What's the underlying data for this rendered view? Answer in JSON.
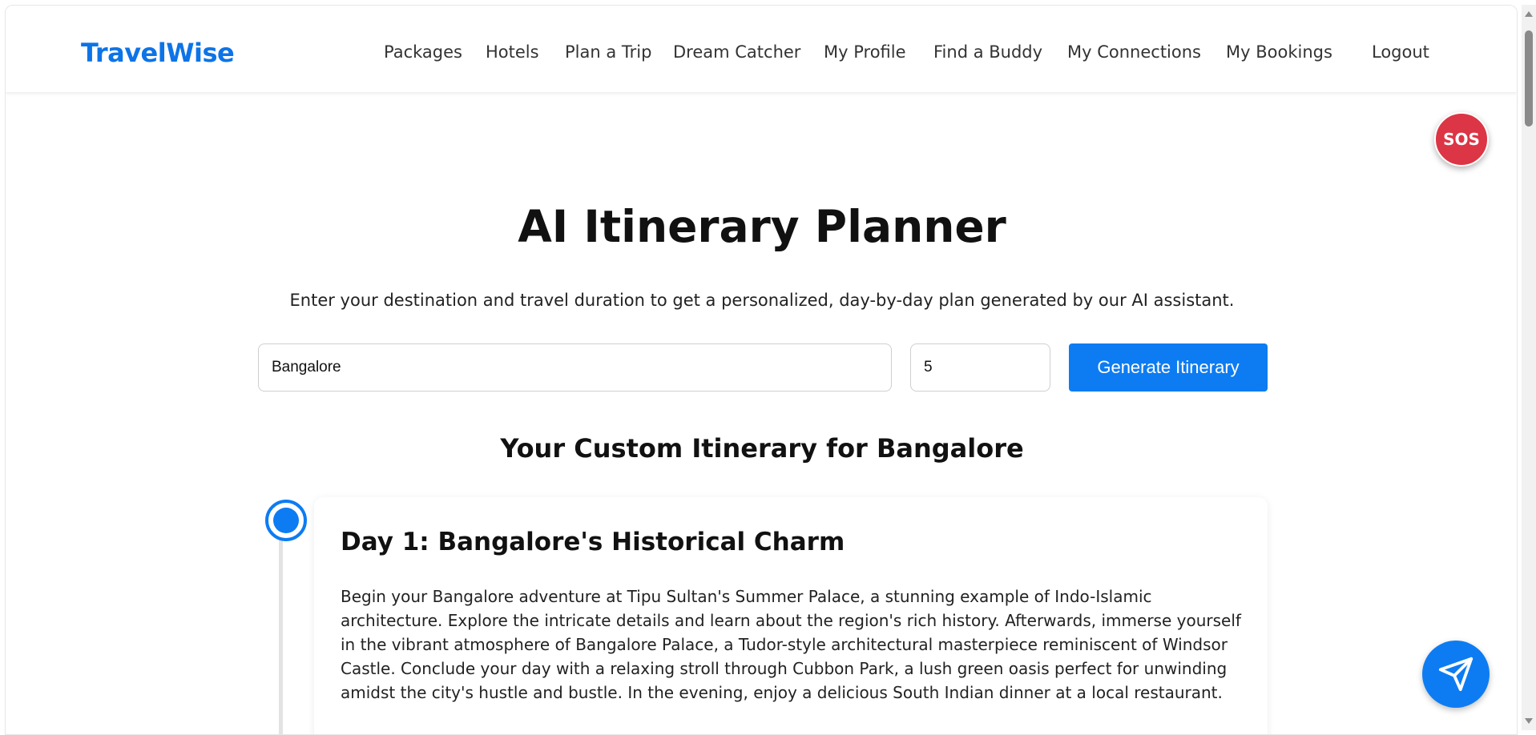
{
  "brand": "TravelWise",
  "nav": {
    "items": [
      "Packages",
      "Hotels",
      "Plan a Trip",
      "Dream Catcher",
      "My Profile",
      "Find a Buddy",
      "My Connections",
      "My Bookings",
      "Logout"
    ]
  },
  "sos": {
    "label": "SOS",
    "color": "#dc3545"
  },
  "planner": {
    "title": "AI Itinerary Planner",
    "subtitle": "Enter your destination and travel duration to get a personalized, day-by-day plan generated by our AI assistant.",
    "destination_value": "Bangalore",
    "days_value": "5",
    "generate_label": "Generate Itinerary",
    "accent": "#0d7cf2"
  },
  "itinerary": {
    "heading": "Your Custom Itinerary for Bangalore",
    "days": [
      {
        "title": "Day 1: Bangalore's Historical Charm",
        "description": "Begin your Bangalore adventure at Tipu Sultan's Summer Palace, a stunning example of Indo-Islamic architecture. Explore the intricate details and learn about the region's rich history. Afterwards, immerse yourself in the vibrant atmosphere of Bangalore Palace, a Tudor-style architectural masterpiece reminiscent of Windsor Castle. Conclude your day with a relaxing stroll through Cubbon Park, a lush green oasis perfect for unwinding amidst the city's hustle and bustle. In the evening, enjoy a delicious South Indian dinner at a local restaurant."
      }
    ]
  },
  "fab": {
    "icon": "send-icon"
  }
}
